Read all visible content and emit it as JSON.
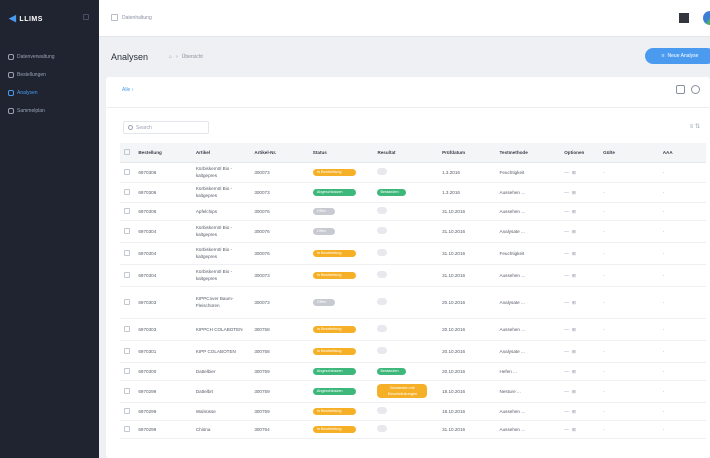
{
  "sidebar": {
    "logo": "LLIMS",
    "items": [
      {
        "label": "Datenverwaltung",
        "active": false
      },
      {
        "label": "Bestellungen",
        "active": false
      },
      {
        "label": "Analysen",
        "active": true
      },
      {
        "label": "Sammelplan",
        "active": false
      }
    ]
  },
  "topbar": {
    "crumb": "Datenhaltung"
  },
  "header": {
    "title": "Analysen",
    "breadcrumb": "Übersicht",
    "new_button": "Neue Analyse"
  },
  "card": {
    "filter_link": "Alle",
    "search_placeholder": "Search",
    "tools": "≡  ⇅"
  },
  "table": {
    "columns": [
      "Bestellung",
      "Artikel",
      "Artikel-Nr.",
      "Status",
      "Resultat",
      "Prüfdatum",
      "Testmethode",
      "Optionen",
      "Gülte",
      "AAA"
    ],
    "rows": [
      {
        "order": "6970306",
        "article": "Kürbiskernöl Bio - kaltgepres",
        "artnr": "300073",
        "status": "In Bearbeitung",
        "status_color": "orange",
        "result": "",
        "result_type": "empty",
        "date": "1.3.2016",
        "method": "Feuchtigkeit",
        "h": 20
      },
      {
        "order": "6970306",
        "article": "Kürbiskernöl Bio - kaltgepres",
        "artnr": "300073",
        "status": "Abgeschlossen",
        "status_color": "green",
        "result": "Bestanden",
        "result_type": "ok",
        "date": "1.3.2016",
        "method": "Aussehen ...",
        "h": 20
      },
      {
        "order": "6970306",
        "article": "Apfelchips",
        "artnr": "300076",
        "status": "Offen",
        "status_color": "gray",
        "result": "",
        "result_type": "empty",
        "date": "31.10.2016",
        "method": "Aussehen ...",
        "h": 18
      },
      {
        "order": "6970304",
        "article": "Kürbiskernöl Bio - kaltgepres",
        "artnr": "300076",
        "status": "Offen",
        "status_color": "gray",
        "result": "",
        "result_type": "empty",
        "date": "31.10.2016",
        "method": "Analysate ...",
        "h": 22
      },
      {
        "order": "6970304",
        "article": "Kürbiskernöl Bio - kaltgepres",
        "artnr": "300076",
        "status": "In Bearbeitung",
        "status_color": "orange",
        "result": "",
        "result_type": "empty",
        "date": "31.10.2016",
        "method": "Feuchtigkeit",
        "h": 22
      },
      {
        "order": "6970304",
        "article": "Kürbiskernöl Bio - kaltgepres",
        "artnr": "300073",
        "status": "In Bearbeitung",
        "status_color": "orange",
        "result": "",
        "result_type": "empty",
        "date": "31.10.2016",
        "method": "Aussehen ...",
        "h": 22
      },
      {
        "order": "6970303",
        "article": "KIPPCover Baum-Fleischüren",
        "artnr": "300073",
        "status": "Offen",
        "status_color": "gray",
        "result": "",
        "result_type": "empty",
        "date": "20.10.2016",
        "method": "Analysate ...",
        "h": 32
      },
      {
        "order": "6970303",
        "article": "KIPPCH COLABOTEN",
        "artnr": "300758",
        "status": "In Bearbeitung",
        "status_color": "orange",
        "result": "",
        "result_type": "empty",
        "date": "20.10.2016",
        "method": "Aussehen ...",
        "h": 22
      },
      {
        "order": "6970301",
        "article": "KIPP COLABOTEN",
        "artnr": "300758",
        "status": "In Bearbeitung",
        "status_color": "orange",
        "result": "",
        "result_type": "empty",
        "date": "20.10.2016",
        "method": "Analysate ...",
        "h": 22
      },
      {
        "order": "6970300",
        "article": "Dattelbier",
        "artnr": "300759",
        "status": "Abgeschlossen",
        "status_color": "green",
        "result": "Bestanden",
        "result_type": "ok",
        "date": "20.10.2016",
        "method": "Hefen ...",
        "h": 18
      },
      {
        "order": "6970299",
        "article": "Dattelbrt",
        "artnr": "300759",
        "status": "Abgeschlossen",
        "status_color": "green",
        "result": "Bestanden mit Einschränkungen",
        "result_type": "warn",
        "date": "18.10.2016",
        "method": "Nesture ...",
        "h": 22
      },
      {
        "order": "6970299",
        "article": "Walnüsse",
        "artnr": "300759",
        "status": "In Bearbeitung",
        "status_color": "orange",
        "result": "",
        "result_type": "empty",
        "date": "18.10.2016",
        "method": "Aussehen ...",
        "h": 18
      },
      {
        "order": "6970299",
        "article": "Chiöna",
        "artnr": "300764",
        "status": "In Bearbeitung",
        "status_color": "orange",
        "result": "",
        "result_type": "empty",
        "date": "31.10.2016",
        "method": "Aussehen ...",
        "h": 18
      }
    ],
    "option_symbols": "— ⊞",
    "dash": "-"
  }
}
